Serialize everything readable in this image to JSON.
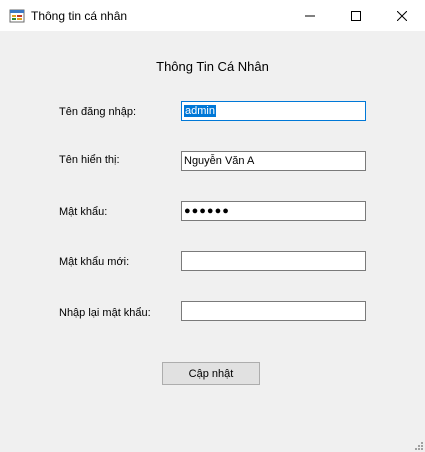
{
  "window": {
    "title": "Thông tin cá nhân",
    "icon": "app-form-icon"
  },
  "form": {
    "heading": "Thông Tin Cá Nhân",
    "username_label": "Tên đăng nhập:",
    "username_value": "admin",
    "display_name_label": "Tên hiển thị:",
    "display_name_value": "Nguyễn Văn A",
    "password_label": "Mật khẩu:",
    "password_value": "●●●●●●",
    "new_password_label": "Mật khẩu mới:",
    "new_password_value": "",
    "confirm_password_label": "Nhập lại mật khẩu:",
    "confirm_password_value": "",
    "update_button": "Cập nhật"
  },
  "colors": {
    "selection": "#0078d7",
    "background": "#f0f0f0"
  }
}
